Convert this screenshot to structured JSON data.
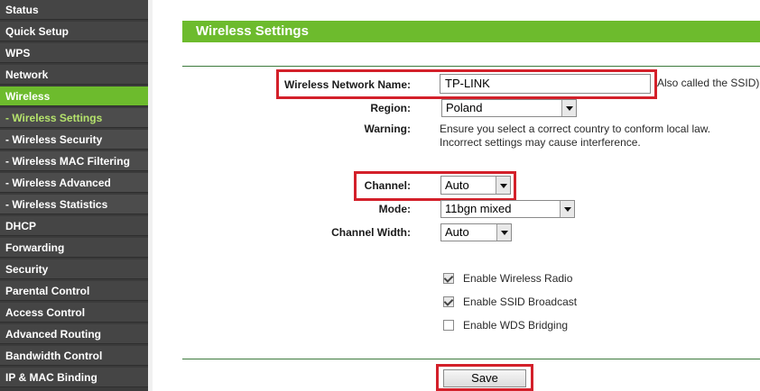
{
  "sidebar": {
    "items": [
      {
        "label": "Status",
        "sub": false,
        "active": false
      },
      {
        "label": "Quick Setup",
        "sub": false,
        "active": false
      },
      {
        "label": "WPS",
        "sub": false,
        "active": false
      },
      {
        "label": "Network",
        "sub": false,
        "active": false
      },
      {
        "label": "Wireless",
        "sub": false,
        "active": true
      },
      {
        "label": "- Wireless Settings",
        "sub": true,
        "active": true
      },
      {
        "label": "- Wireless Security",
        "sub": true,
        "active": false
      },
      {
        "label": "- Wireless MAC Filtering",
        "sub": true,
        "active": false
      },
      {
        "label": "- Wireless Advanced",
        "sub": true,
        "active": false
      },
      {
        "label": "- Wireless Statistics",
        "sub": true,
        "active": false
      },
      {
        "label": "DHCP",
        "sub": false,
        "active": false
      },
      {
        "label": "Forwarding",
        "sub": false,
        "active": false
      },
      {
        "label": "Security",
        "sub": false,
        "active": false
      },
      {
        "label": "Parental Control",
        "sub": false,
        "active": false
      },
      {
        "label": "Access Control",
        "sub": false,
        "active": false
      },
      {
        "label": "Advanced Routing",
        "sub": false,
        "active": false
      },
      {
        "label": "Bandwidth Control",
        "sub": false,
        "active": false
      },
      {
        "label": "IP & MAC Binding",
        "sub": false,
        "active": false
      }
    ]
  },
  "header": {
    "title": "Wireless Settings"
  },
  "form": {
    "network_name": {
      "label": "Wireless Network Name:",
      "value": "TP-LINK",
      "hint": "Also called the SSID)"
    },
    "region": {
      "label": "Region:",
      "value": "Poland"
    },
    "warning": {
      "label": "Warning:",
      "line1": "Ensure you select a correct country to conform local law.",
      "line2": "Incorrect settings may cause interference."
    },
    "channel": {
      "label": "Channel:",
      "value": "Auto"
    },
    "mode": {
      "label": "Mode:",
      "value": "11bgn mixed"
    },
    "channel_width": {
      "label": "Channel Width:",
      "value": "Auto"
    },
    "options": [
      {
        "label": "Enable Wireless Radio",
        "checked": true
      },
      {
        "label": "Enable SSID Broadcast",
        "checked": true
      },
      {
        "label": "Enable WDS Bridging",
        "checked": false
      }
    ]
  },
  "actions": {
    "save_label": "Save"
  },
  "colors": {
    "accent_green": "#6dbb2d",
    "highlight_red": "#d3202a",
    "sidebar_bg": "#3b3b3b"
  }
}
